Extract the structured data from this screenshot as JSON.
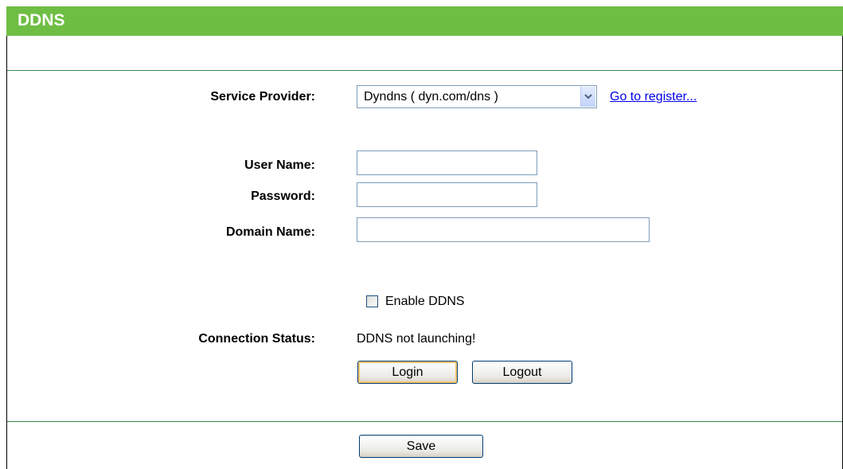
{
  "header": {
    "title": "DDNS"
  },
  "form": {
    "service_provider_label": "Service Provider:",
    "service_provider_value": "Dyndns ( dyn.com/dns )",
    "register_link": "Go to register...",
    "username_label": "User Name:",
    "username_value": "",
    "password_label": "Password:",
    "password_value": "",
    "domain_label": "Domain Name:",
    "domain_value": "",
    "enable_ddns_label": "Enable DDNS",
    "enable_ddns_checked": false,
    "connection_status_label": "Connection Status:",
    "connection_status_value": "DDNS not launching!",
    "login_button": "Login",
    "logout_button": "Logout",
    "save_button": "Save"
  },
  "colors": {
    "title_bar": "#6fbe44",
    "divider": "#3a8a4a",
    "link": "#0000ee"
  },
  "icons": {
    "dropdown": "chevron-down-icon"
  }
}
